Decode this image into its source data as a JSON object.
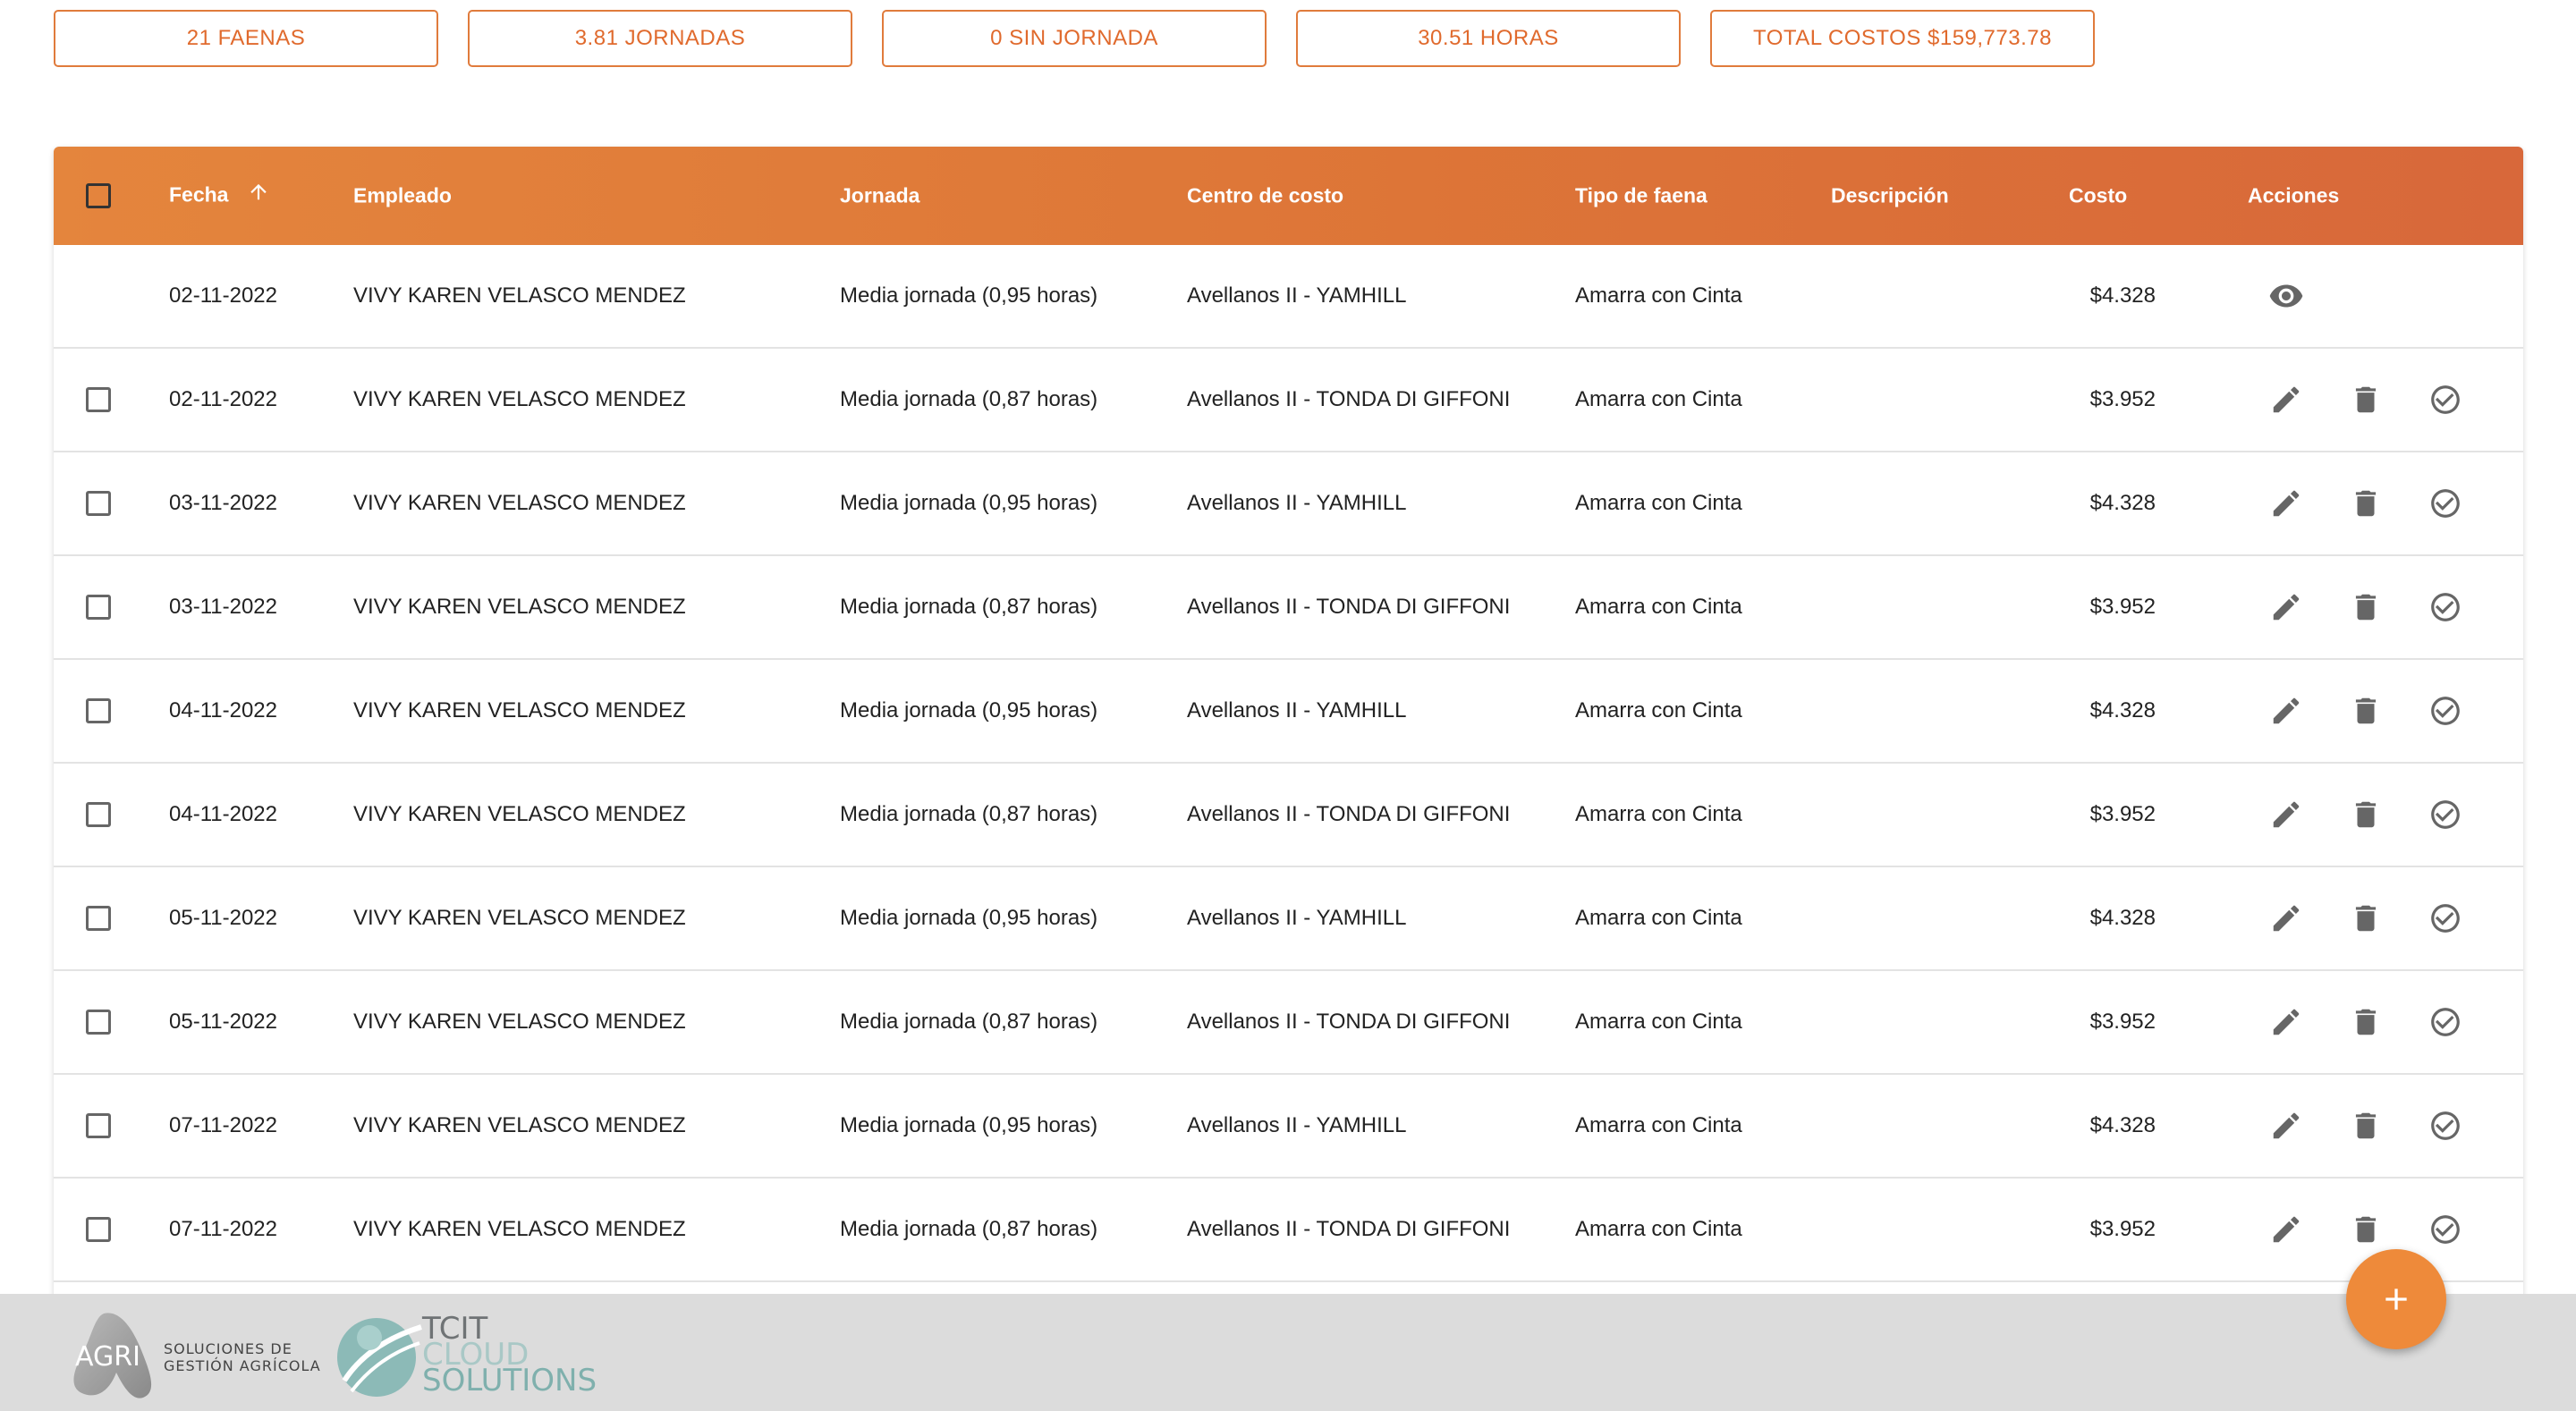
{
  "summary": [
    {
      "label": "21 FAENAS"
    },
    {
      "label": "3.81 JORNADAS"
    },
    {
      "label": "0 SIN JORNADA"
    },
    {
      "label": "30.51 HORAS"
    },
    {
      "label": "TOTAL COSTOS $159,773.78"
    }
  ],
  "table": {
    "headers": {
      "fecha": "Fecha",
      "empleado": "Empleado",
      "jornada": "Jornada",
      "centro": "Centro de costo",
      "tipo": "Tipo de faena",
      "descripcion": "Descripción",
      "costo": "Costo",
      "acciones": "Acciones"
    },
    "rows": [
      {
        "fecha": "02-11-2022",
        "empleado": "VIVY KAREN VELASCO MENDEZ",
        "jornada": "Media jornada (0,95 horas)",
        "centro": "Avellanos II - YAMHILL",
        "tipo": "Amarra con Cinta",
        "descripcion": "",
        "costo": "$4.328"
      },
      {
        "fecha": "02-11-2022",
        "empleado": "VIVY KAREN VELASCO MENDEZ",
        "jornada": "Media jornada (0,87 horas)",
        "centro": "Avellanos II - TONDA DI GIFFONI",
        "tipo": "Amarra con Cinta",
        "descripcion": "",
        "costo": "$3.952"
      },
      {
        "fecha": "03-11-2022",
        "empleado": "VIVY KAREN VELASCO MENDEZ",
        "jornada": "Media jornada (0,95 horas)",
        "centro": "Avellanos II - YAMHILL",
        "tipo": "Amarra con Cinta",
        "descripcion": "",
        "costo": "$4.328"
      },
      {
        "fecha": "03-11-2022",
        "empleado": "VIVY KAREN VELASCO MENDEZ",
        "jornada": "Media jornada (0,87 horas)",
        "centro": "Avellanos II - TONDA DI GIFFONI",
        "tipo": "Amarra con Cinta",
        "descripcion": "",
        "costo": "$3.952"
      },
      {
        "fecha": "04-11-2022",
        "empleado": "VIVY KAREN VELASCO MENDEZ",
        "jornada": "Media jornada (0,95 horas)",
        "centro": "Avellanos II - YAMHILL",
        "tipo": "Amarra con Cinta",
        "descripcion": "",
        "costo": "$4.328"
      },
      {
        "fecha": "04-11-2022",
        "empleado": "VIVY KAREN VELASCO MENDEZ",
        "jornada": "Media jornada (0,87 horas)",
        "centro": "Avellanos II - TONDA DI GIFFONI",
        "tipo": "Amarra con Cinta",
        "descripcion": "",
        "costo": "$3.952"
      },
      {
        "fecha": "05-11-2022",
        "empleado": "VIVY KAREN VELASCO MENDEZ",
        "jornada": "Media jornada (0,95 horas)",
        "centro": "Avellanos II - YAMHILL",
        "tipo": "Amarra con Cinta",
        "descripcion": "",
        "costo": "$4.328"
      },
      {
        "fecha": "05-11-2022",
        "empleado": "VIVY KAREN VELASCO MENDEZ",
        "jornada": "Media jornada (0,87 horas)",
        "centro": "Avellanos II - TONDA DI GIFFONI",
        "tipo": "Amarra con Cinta",
        "descripcion": "",
        "costo": "$3.952"
      },
      {
        "fecha": "07-11-2022",
        "empleado": "VIVY KAREN VELASCO MENDEZ",
        "jornada": "Media jornada (0,95 horas)",
        "centro": "Avellanos II - YAMHILL",
        "tipo": "Amarra con Cinta",
        "descripcion": "",
        "costo": "$4.328"
      },
      {
        "fecha": "07-11-2022",
        "empleado": "VIVY KAREN VELASCO MENDEZ",
        "jornada": "Media jornada (0,87 horas)",
        "centro": "Avellanos II - TONDA DI GIFFONI",
        "tipo": "Amarra con Cinta",
        "descripcion": "",
        "costo": "$3.952"
      }
    ]
  },
  "icons": {
    "sort": "arrow-up-icon",
    "view": "eye-icon",
    "edit": "pencil-icon",
    "delete": "trash-icon",
    "approve": "check-circle-icon",
    "fab": "plus-icon"
  },
  "footer": {
    "agri_logo_text": "AGRI",
    "agri_tagline_1": "SOLUCIONES DE",
    "agri_tagline_2": "GESTIÓN AGRÍCOLA",
    "tcit_line1": "TCIT",
    "tcit_line2": "CLOUD",
    "tcit_line3": "SOLUTIONS"
  },
  "colors": {
    "accent": "#e07b3c",
    "header_start": "#e4853d",
    "header_end": "#d8683a",
    "fab": "#ee8a3a",
    "footer_bg": "#dcdcdc",
    "icon_gray": "#666666"
  }
}
